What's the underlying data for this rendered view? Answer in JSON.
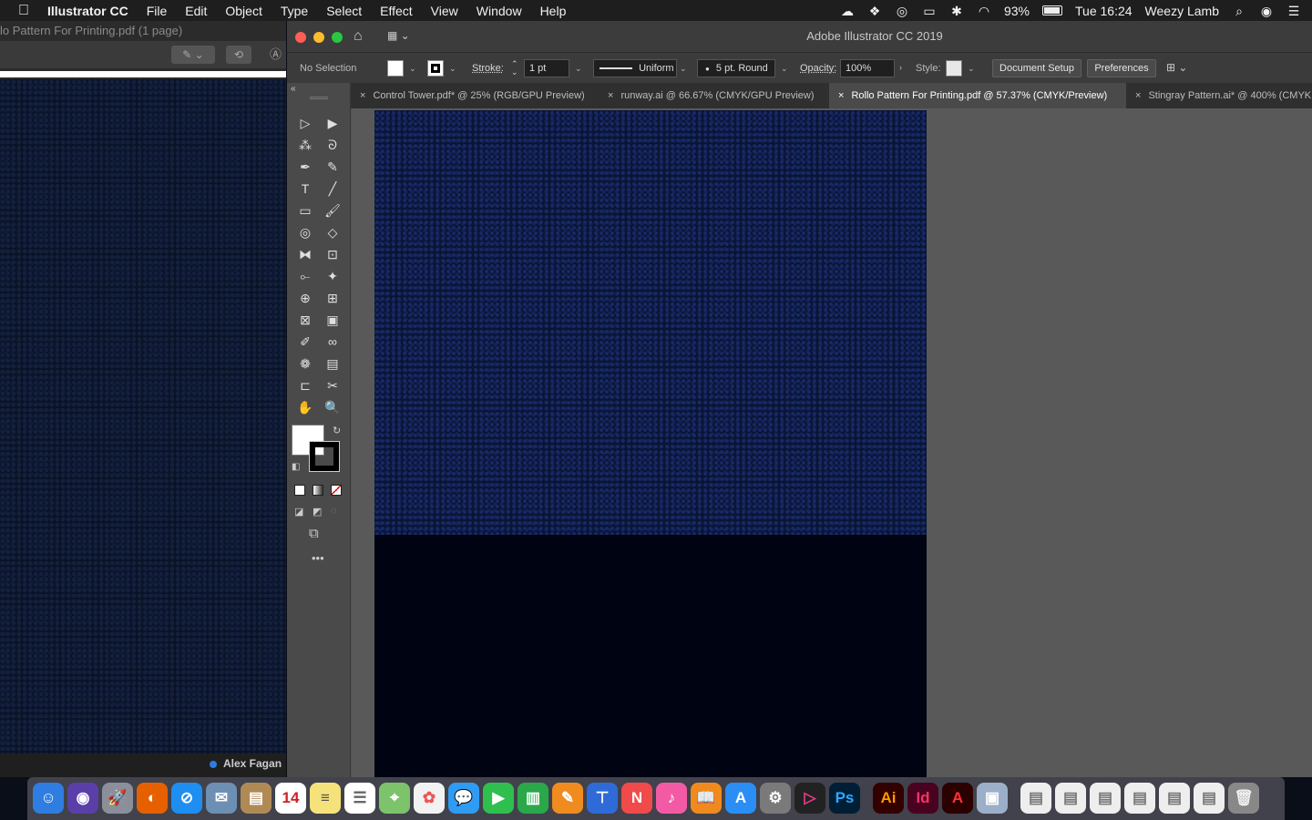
{
  "menubar": {
    "app": "Illustrator CC",
    "items": [
      "File",
      "Edit",
      "Object",
      "Type",
      "Select",
      "Effect",
      "View",
      "Window",
      "Help"
    ],
    "battery": "93%",
    "clock": "Tue 16:24",
    "user": "Weezy Lamb"
  },
  "left_window": {
    "title": "lo Pattern For Printing.pdf (1 page)",
    "footer_name": "Alex Fagan"
  },
  "main_window": {
    "title": "Adobe Illustrator CC 2019"
  },
  "control_bar": {
    "selection": "No Selection",
    "stroke_label": "Stroke:",
    "stroke_value": "1 pt",
    "profile": "Uniform",
    "brush": "5 pt. Round",
    "opacity_label": "Opacity:",
    "opacity_value": "100%",
    "style_label": "Style:",
    "document_setup": "Document Setup",
    "preferences": "Preferences"
  },
  "tabs": [
    {
      "label": "Control Tower.pdf* @ 25% (RGB/GPU Preview)",
      "active": false
    },
    {
      "label": "runway.ai @ 66.67% (CMYK/GPU Preview)",
      "active": false
    },
    {
      "label": "Rollo Pattern For Printing.pdf @ 57.37% (CMYK/Preview)",
      "active": true
    },
    {
      "label": "Stingray Pattern.ai* @ 400% (CMYK",
      "active": false
    }
  ],
  "tools": [
    "selection-tool",
    "direct-selection-tool",
    "magic-wand-tool",
    "lasso-tool",
    "pen-tool",
    "curvature-tool",
    "type-tool",
    "line-tool",
    "rectangle-tool",
    "paintbrush-tool",
    "shaper-tool",
    "eraser-tool",
    "reflect-tool",
    "scale-tool",
    "width-tool",
    "puppet-warp-tool",
    "shape-builder-tool",
    "perspective-grid-tool",
    "mesh-tool",
    "gradient-tool",
    "eyedropper-tool",
    "blend-tool",
    "symbol-sprayer-tool",
    "graph-tool",
    "artboard-tool",
    "slice-tool",
    "hand-tool",
    "zoom-tool"
  ],
  "tool_glyphs": [
    "▷",
    "▶",
    "⁂",
    "ᘐ",
    "✒",
    "✎",
    "T",
    "╱",
    "▭",
    "🖌",
    "◎",
    "◇",
    "⧓",
    "⊡",
    "⟜",
    "✦",
    "⊕",
    "⊞",
    "⊠",
    "▣",
    "✐",
    "∞",
    "❁",
    "▤",
    "⊏",
    "✂",
    "✋",
    "🔍"
  ],
  "dock_apps": [
    {
      "name": "finder",
      "glyph": "☺",
      "bg": "#2f7de1",
      "fg": "#fff"
    },
    {
      "name": "siri",
      "glyph": "◉",
      "bg": "#5b3fa8",
      "fg": "#fff"
    },
    {
      "name": "launchpad",
      "glyph": "🚀",
      "bg": "#8a8f99",
      "fg": "#fff"
    },
    {
      "name": "firefox",
      "glyph": "◐",
      "bg": "#e66000",
      "fg": "#fff"
    },
    {
      "name": "safari",
      "glyph": "⊘",
      "bg": "#1e8ef0",
      "fg": "#fff"
    },
    {
      "name": "mail-stamp",
      "glyph": "✉",
      "bg": "#6d8fb3",
      "fg": "#fff"
    },
    {
      "name": "contacts",
      "glyph": "▤",
      "bg": "#b08a55",
      "fg": "#fff"
    },
    {
      "name": "calendar",
      "glyph": "14",
      "bg": "#fff",
      "fg": "#c22"
    },
    {
      "name": "notes",
      "glyph": "≡",
      "bg": "#f5e27a",
      "fg": "#555"
    },
    {
      "name": "reminders",
      "glyph": "☰",
      "bg": "#fff",
      "fg": "#666"
    },
    {
      "name": "maps",
      "glyph": "⌖",
      "bg": "#7cc36b",
      "fg": "#fff"
    },
    {
      "name": "photos",
      "glyph": "✿",
      "bg": "#f2f2f2",
      "fg": "#e55"
    },
    {
      "name": "messages",
      "glyph": "💬",
      "bg": "#2f9bf3",
      "fg": "#fff"
    },
    {
      "name": "facetime",
      "glyph": "▶",
      "bg": "#2fbf4f",
      "fg": "#fff"
    },
    {
      "name": "numbers",
      "glyph": "▥",
      "bg": "#2aa84a",
      "fg": "#fff"
    },
    {
      "name": "pages",
      "glyph": "✎",
      "bg": "#f08b1f",
      "fg": "#fff"
    },
    {
      "name": "keynote",
      "glyph": "⊤",
      "bg": "#2f6bd8",
      "fg": "#fff"
    },
    {
      "name": "news",
      "glyph": "N",
      "bg": "#f04a4a",
      "fg": "#fff"
    },
    {
      "name": "itunes",
      "glyph": "♪",
      "bg": "#f35aa5",
      "fg": "#fff"
    },
    {
      "name": "books",
      "glyph": "📖",
      "bg": "#f08a1f",
      "fg": "#fff"
    },
    {
      "name": "app-store",
      "glyph": "A",
      "bg": "#2a8ef5",
      "fg": "#fff"
    },
    {
      "name": "system-preferences",
      "glyph": "⚙",
      "bg": "#7a7a7a",
      "fg": "#fff"
    },
    {
      "name": "media-player",
      "glyph": "▷",
      "bg": "#222",
      "fg": "#e73c8a"
    },
    {
      "name": "photoshop",
      "glyph": "Ps",
      "bg": "#001e36",
      "fg": "#31a8ff"
    },
    {
      "name": "illustrator",
      "glyph": "Ai",
      "bg": "#330000",
      "fg": "#ff9a00"
    },
    {
      "name": "indesign",
      "glyph": "Id",
      "bg": "#49021f",
      "fg": "#ff3366"
    },
    {
      "name": "acrobat",
      "glyph": "A",
      "bg": "#2a0000",
      "fg": "#f33"
    },
    {
      "name": "preview",
      "glyph": "▣",
      "bg": "#9bb0c8",
      "fg": "#fff"
    },
    {
      "name": "doc-1",
      "glyph": "▤",
      "bg": "#eee",
      "fg": "#777"
    },
    {
      "name": "doc-2",
      "glyph": "▤",
      "bg": "#eee",
      "fg": "#777"
    },
    {
      "name": "doc-3",
      "glyph": "▤",
      "bg": "#eee",
      "fg": "#777"
    },
    {
      "name": "doc-4",
      "glyph": "▤",
      "bg": "#eee",
      "fg": "#777"
    },
    {
      "name": "doc-5",
      "glyph": "▤",
      "bg": "#eee",
      "fg": "#777"
    },
    {
      "name": "doc-6",
      "glyph": "▤",
      "bg": "#eee",
      "fg": "#777"
    },
    {
      "name": "trash",
      "glyph": "🗑",
      "bg": "#888",
      "fg": "#eee"
    }
  ]
}
